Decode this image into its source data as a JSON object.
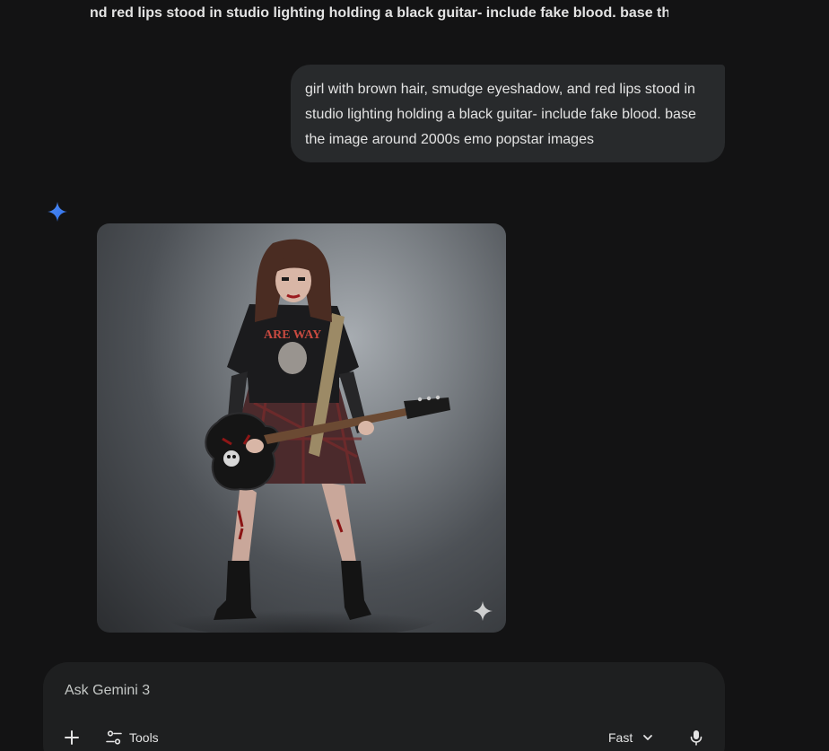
{
  "conversation": {
    "previous_title": "nd red lips stood in studio lighting holding a black guitar- include fake blood. base the",
    "user_message": "girl with brown hair, smudge eyeshadow, and red lips stood in studio lighting holding a black guitar- include fake blood. base the image around 2000s emo popstar images",
    "response_icon": "gemini-spark-icon",
    "generated_image_alt": "Generated image: girl with brown hair and emo makeup holding a black electric guitar in studio lighting",
    "shirt_print": "ARE WAY"
  },
  "composer": {
    "placeholder": "Ask Gemini 3",
    "tools_label": "Tools",
    "mode_label": "Fast",
    "icons": {
      "add": "plus-icon",
      "tools": "tune-icon",
      "mode": "chevron-down-icon",
      "voice": "mic-icon"
    }
  },
  "colors": {
    "background": "#131314",
    "bubble": "#282a2c",
    "composer": "#1e1f20",
    "spark_blue": "#4285f4",
    "text": "#e3e3e3"
  }
}
